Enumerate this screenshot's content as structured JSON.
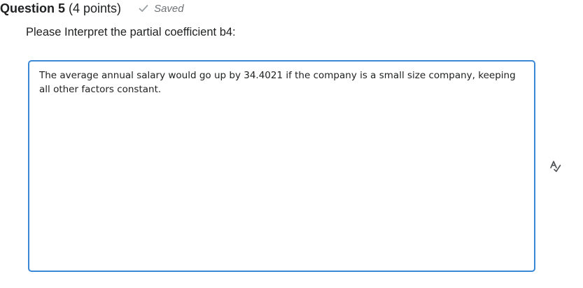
{
  "question": {
    "title": "Question 5",
    "points": "(4 points)",
    "saved_status": "Saved",
    "prompt": "Please Interpret the partial coefficient b4:"
  },
  "answer": {
    "text": "The average annual salary would go up by 34.4021 if the company is a small size company, keeping all other factors constant."
  },
  "icons": {
    "saved": "checkmark-icon",
    "spellcheck": "spellcheck-icon"
  },
  "colors": {
    "focus_border": "#3a87d6",
    "muted_text": "#6e7376",
    "body_text": "#202122"
  }
}
